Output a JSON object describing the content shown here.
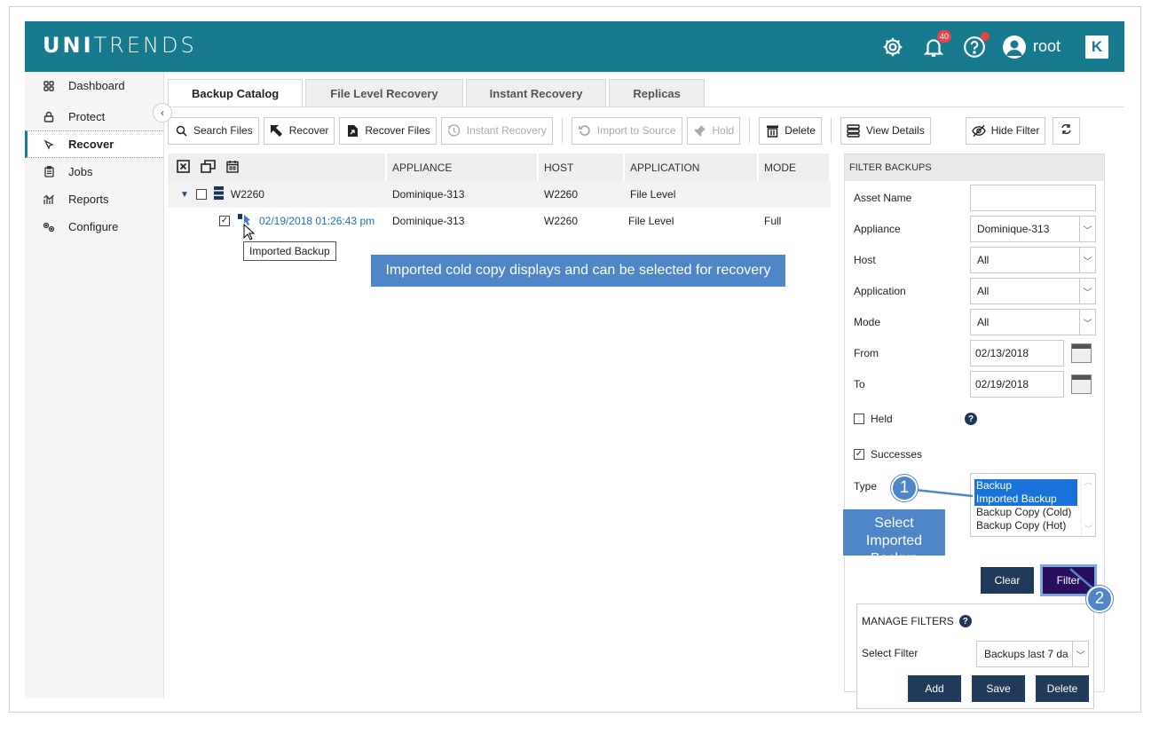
{
  "header": {
    "logo_bold": "UNI",
    "logo_light": "TRENDS",
    "notification_count": "40",
    "username": "root",
    "brand_mark": "K",
    "icons": [
      "gear-icon",
      "bell-icon",
      "help-icon",
      "user-icon"
    ]
  },
  "sidebar": {
    "items": [
      {
        "label": "Dashboard",
        "icon": "dashboard-icon"
      },
      {
        "label": "Protect",
        "icon": "lock-icon"
      },
      {
        "label": "Recover",
        "icon": "cursor-icon",
        "active": true
      },
      {
        "label": "Jobs",
        "icon": "clipboard-icon"
      },
      {
        "label": "Reports",
        "icon": "chart-icon"
      },
      {
        "label": "Configure",
        "icon": "gears-icon"
      }
    ],
    "collapse_glyph": "‹"
  },
  "tabs": [
    {
      "label": "Backup Catalog",
      "active": true
    },
    {
      "label": "File Level Recovery"
    },
    {
      "label": "Instant Recovery"
    },
    {
      "label": "Replicas"
    }
  ],
  "toolbar": {
    "search_files": "Search Files",
    "recover": "Recover",
    "recover_files": "Recover Files",
    "instant_recovery": "Instant Recovery",
    "import_to_source": "Import to Source",
    "hold": "Hold",
    "delete": "Delete",
    "view_details": "View Details",
    "hide_filter": "Hide Filter"
  },
  "grid": {
    "columns": [
      "APPLIANCE",
      "HOST",
      "APPLICATION",
      "MODE"
    ],
    "group_row": {
      "name": "W2260",
      "appliance": "Dominique-313",
      "host": "W2260",
      "application": "File Level",
      "mode": ""
    },
    "backup_row": {
      "date": "02/19/2018 01:26:43 pm",
      "appliance": "Dominique-313",
      "host": "W2260",
      "application": "File Level",
      "mode": "Full"
    },
    "tooltip": "Imported Backup",
    "banner": "Imported cold copy displays and can be selected for recovery"
  },
  "filter": {
    "title": "FILTER BACKUPS",
    "asset_name_label": "Asset Name",
    "asset_name_value": "",
    "appliance_label": "Appliance",
    "appliance_value": "Dominique-313",
    "host_label": "Host",
    "host_value": "All",
    "application_label": "Application",
    "application_value": "All",
    "mode_label": "Mode",
    "mode_value": "All",
    "from_label": "From",
    "from_value": "02/13/2018",
    "to_label": "To",
    "to_value": "02/19/2018",
    "held_label": "Held",
    "held_checked": false,
    "successes_label": "Successes",
    "successes_checked": true,
    "type_label": "Type",
    "type_options": [
      "Backup",
      "Imported Backup",
      "Backup Copy (Cold)",
      "Backup Copy (Hot)"
    ],
    "clear_label": "Clear",
    "filter_label": "Filter"
  },
  "manage_filters": {
    "title": "MANAGE FILTERS",
    "select_label": "Select Filter",
    "select_value": "Backups last 7 da",
    "add": "Add",
    "save": "Save",
    "delete": "Delete"
  },
  "callouts": {
    "step1": "1",
    "step2": "2",
    "select_line1": "Select",
    "select_line2": "Imported Backup"
  }
}
